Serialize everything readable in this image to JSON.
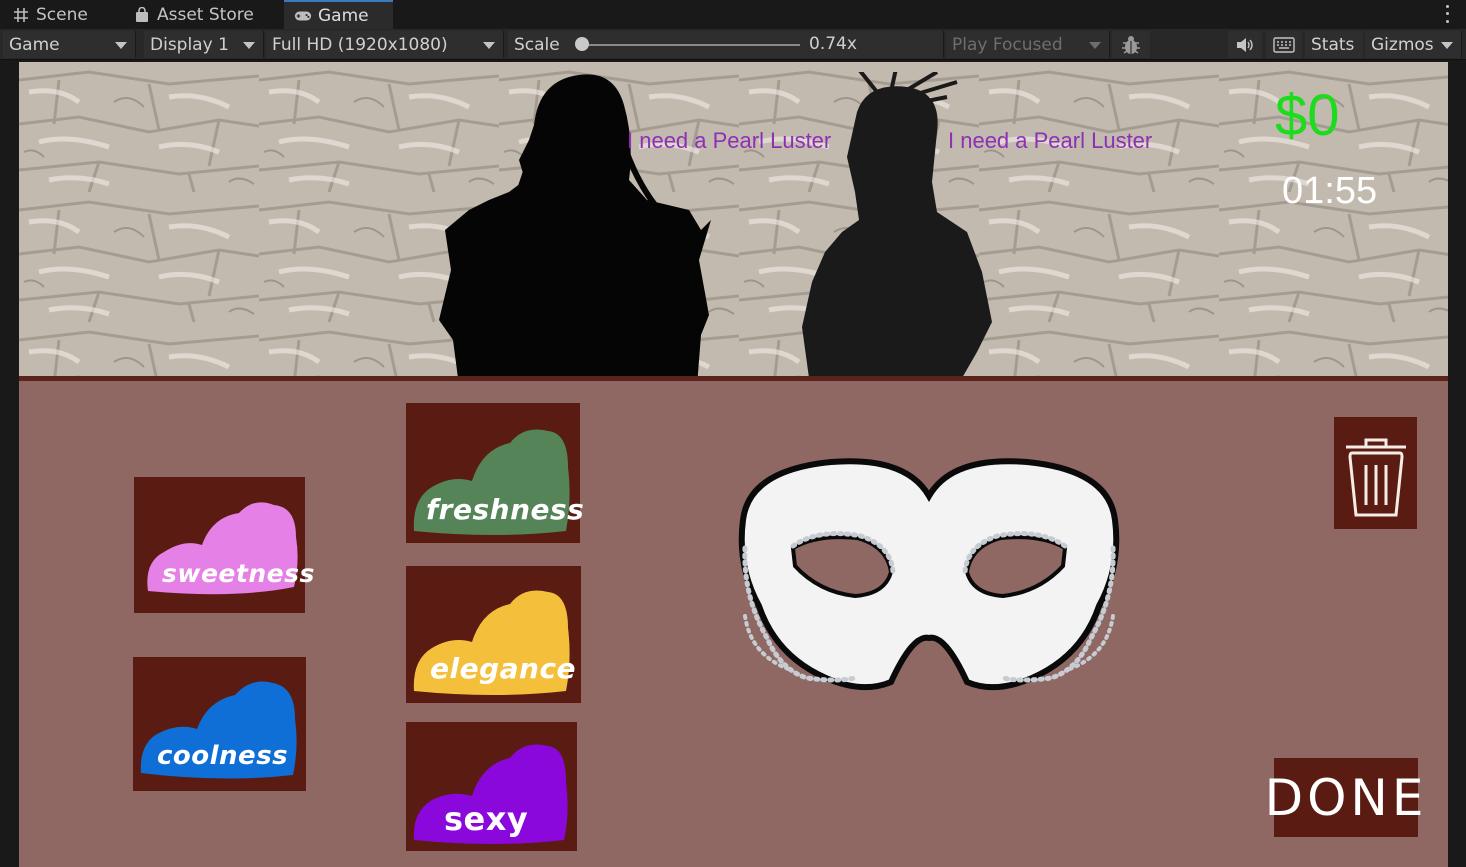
{
  "tabs": [
    {
      "label": "Scene",
      "icon": "grid-icon"
    },
    {
      "label": "Asset Store",
      "icon": "bag-icon"
    },
    {
      "label": "Game",
      "icon": "gamepad-icon",
      "active": true
    }
  ],
  "toolbar": {
    "view_mode": "Game",
    "display": "Display 1",
    "resolution": "Full HD (1920x1080)",
    "scale_label": "Scale",
    "scale_value": "0.74x",
    "play_mode": "Play Focused",
    "stats_label": "Stats",
    "gizmos_label": "Gizmos"
  },
  "game": {
    "money": "$0",
    "timer": "01:55",
    "customers": [
      {
        "request": "I need a Pearl Luster"
      },
      {
        "request": "I need a Pearl Luster"
      }
    ],
    "ingredients": [
      {
        "label": "sweetness",
        "color": "#e580e6"
      },
      {
        "label": "coolness",
        "color": "#0f6fd6"
      },
      {
        "label": "freshness",
        "color": "#548457"
      },
      {
        "label": "elegance",
        "color": "#f4c03c"
      },
      {
        "label": "sexy",
        "color": "#8b08dc"
      }
    ],
    "done_label": "DONE",
    "colors": {
      "wall": "#c5bdb3",
      "counter": "#8f6863",
      "button": "#5a1c12",
      "money": "#1ddb1d",
      "speech": "#8f2fb5"
    }
  }
}
